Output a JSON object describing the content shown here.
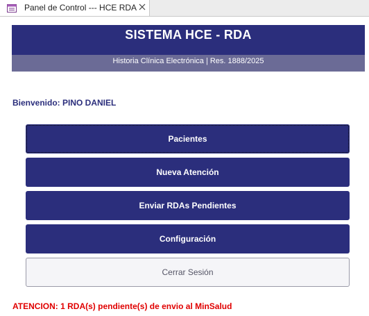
{
  "tab": {
    "title": "Panel de Control --- HCE RDA",
    "icon": "form-icon",
    "close_icon": "close-icon"
  },
  "header": {
    "title": "SISTEMA HCE - RDA",
    "subtitle": "Historia Clínica Electrónica | Res. 1888/2025"
  },
  "welcome": {
    "text": "Bienvenido: PINO DANIEL"
  },
  "menu": {
    "pacientes": "Pacientes",
    "nueva_atencion": "Nueva Atención",
    "enviar_rdas": "Enviar RDAs Pendientes",
    "configuracion": "Configuración",
    "cerrar_sesion": "Cerrar Sesión"
  },
  "alert": {
    "text": "ATENCION: 1 RDA(s) pendiente(s) de envio al MinSalud"
  },
  "colors": {
    "primary": "#2b2e7c",
    "subheader": "#6b6b96",
    "alert": "#e00000"
  }
}
